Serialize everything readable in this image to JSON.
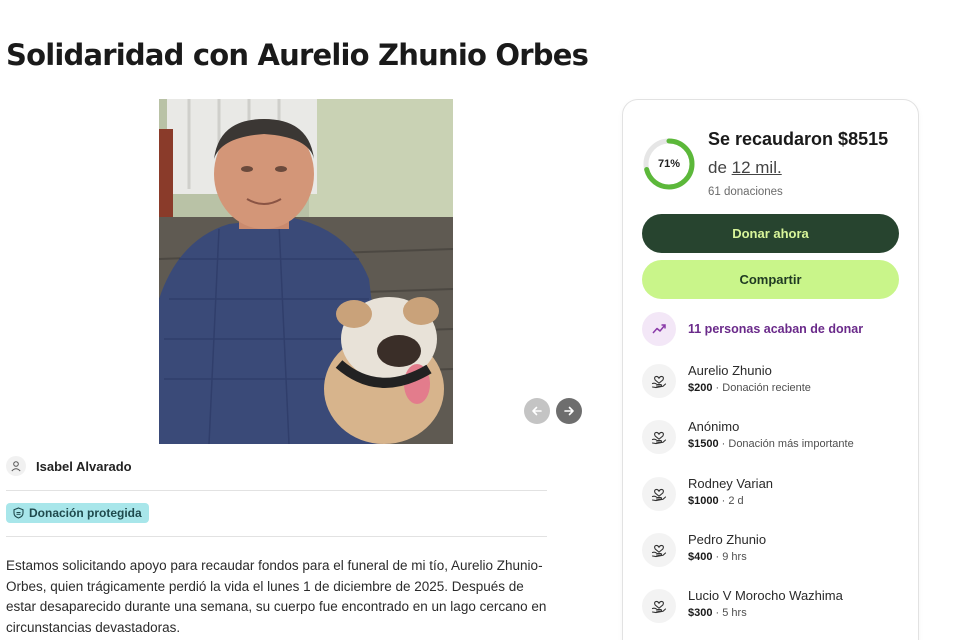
{
  "campaign": {
    "title": "Solidaridad con Aurelio Zhunio Orbes",
    "organizer": "Isabel Alvarado",
    "badge": "Donación protegida",
    "story": [
      "Estamos solicitando apoyo para recaudar fondos para el funeral de mi tío, Aurelio Zhunio-",
      "Orbes, quien trágicamente perdió la vida el lunes 1 de diciembre de 2025. Después de",
      "estar desaparecido durante una semana, su cuerpo fue encontrado en un lago cercano en",
      "circunstancias devastadoras."
    ]
  },
  "progress": {
    "percent_label": "71%",
    "percent": 0.71,
    "raised": "Se recaudaron $8515",
    "goal_prefix": "de ",
    "goal_amount": "12 mil.",
    "donations_count": "61 donaciones"
  },
  "actions": {
    "donate": "Donar ahora",
    "share": "Compartir"
  },
  "recent_notice": "11 personas acaban de donar",
  "donors": [
    {
      "name": "Aurelio Zhunio",
      "amount": "$200",
      "detail": " · Donación reciente"
    },
    {
      "name": "Anónimo",
      "amount": "$1500",
      "detail": " · Donación más importante"
    },
    {
      "name": "Rodney Varian",
      "amount": "$1000",
      "detail": " · 2 d"
    },
    {
      "name": "Pedro Zhunio",
      "amount": "$400",
      "detail": " · 9 hrs"
    },
    {
      "name": "Lucio V Morocho Wazhima",
      "amount": "$300",
      "detail": " · 5 hrs"
    }
  ],
  "icons": {
    "prev": "arrow-left-icon",
    "next": "arrow-right-icon",
    "organizer": "user-icon",
    "badge": "shield-icon",
    "trend": "trending-up-icon",
    "donor": "heart-hand-icon"
  },
  "colors": {
    "donate_bg": "#27442f",
    "share_bg": "#c9f58a",
    "progress_ring": "#5cb83a",
    "trend_text": "#6a2a8a",
    "badge_bg": "#a8e6ea"
  }
}
